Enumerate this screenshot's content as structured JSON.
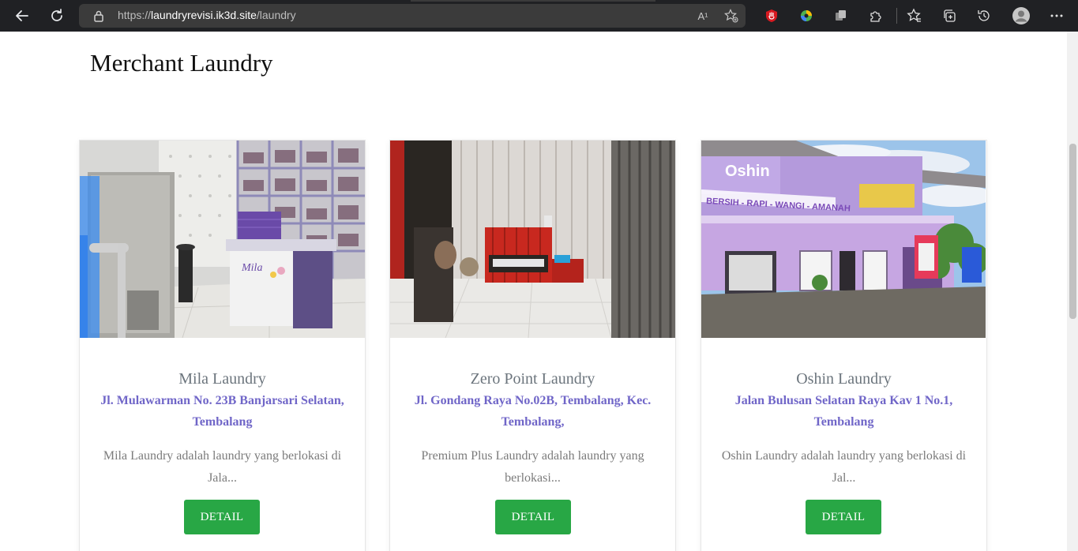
{
  "browser": {
    "url_scheme": "https://",
    "url_host": "laundryrevisi.ik3d.site",
    "url_path": "/laundry",
    "read_aloud_glyph": "A¹",
    "icons": [
      "back-icon",
      "reload-icon",
      "lock-icon",
      "read-aloud-icon",
      "add-favorite-icon",
      "extension-red-icon",
      "extension-color-icon",
      "extension-gray-icon",
      "extensions-icon",
      "favorites-icon",
      "collections-icon",
      "history-icon",
      "profile-avatar-icon",
      "more-icon"
    ]
  },
  "page": {
    "title": "Merchant Laundry"
  },
  "merchants": [
    {
      "name": "Mila Laundry",
      "address": "Jl. Mulawarman No. 23B Banjarsari Selatan, Tembalang",
      "description": "Mila Laundry adalah laundry yang berlokasi di Jala...",
      "photo_sign": "Mila",
      "button": "DETAIL"
    },
    {
      "name": "Zero Point Laundry",
      "address": "Jl. Gondang Raya No.02B, Tembalang, Kec. Tembalang,",
      "description": "Premium Plus Laundry adalah laundry yang berlokasi...",
      "button": "DETAIL"
    },
    {
      "name": "Oshin Laundry",
      "address": "Jalan Bulusan Selatan Raya Kav 1 No.1, Tembalang",
      "description": "Oshin Laundry adalah laundry yang berlokasi di Jal...",
      "photo_sign": "Oshin",
      "photo_banner": "BERSIH - RAPI - WANGI - AMANAH",
      "button": "DETAIL"
    }
  ],
  "colors": {
    "chrome_bg": "#202124",
    "omnibox_bg": "#3b3b3b",
    "address_text": "#7066c8",
    "name_text": "#6c757d",
    "button_green": "#28a745"
  }
}
